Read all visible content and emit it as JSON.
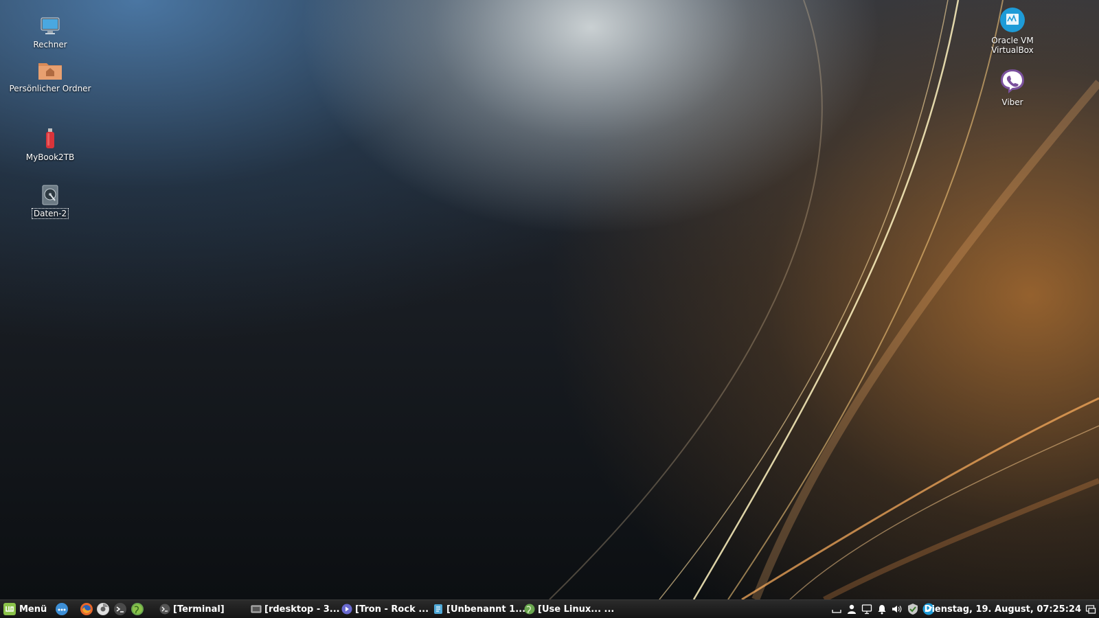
{
  "desktop": {
    "icons": [
      {
        "label": "Rechner",
        "icon": "computer-icon"
      },
      {
        "label": "Persönlicher Ordner",
        "icon": "home-folder-icon"
      },
      {
        "label": "MyBook2TB",
        "icon": "usb-drive-icon"
      },
      {
        "label": "Daten-2",
        "icon": "hard-disk-icon"
      },
      {
        "label": "Oracle VM VirtualBox",
        "icon": "virtualbox-icon"
      },
      {
        "label": "Viber",
        "icon": "viber-icon"
      }
    ]
  },
  "taskbar": {
    "menu_label": "Menü",
    "launchers": [
      "show-desktop-icon",
      "firefox-icon",
      "chrome-icon",
      "terminal-icon",
      "web-browser-icon"
    ],
    "windows": [
      {
        "label": "[Terminal]",
        "icon": "terminal-icon"
      },
      {
        "label": "[rdesktop - 3...",
        "icon": "window-icon"
      },
      {
        "label": "[Tron - Rock ...",
        "icon": "media-player-icon"
      },
      {
        "label": "[Unbenannt 1...",
        "icon": "document-icon"
      },
      {
        "label": "[Use Linux... ...",
        "icon": "web-browser-icon"
      }
    ],
    "tray": [
      "keyboard-icon",
      "user-icon",
      "network-icon",
      "notification-icon",
      "volume-icon",
      "shield-icon",
      "update-icon"
    ],
    "clock": "Dienstag, 19. August, 07:25:24",
    "show_desktop": "show-desktop-icon"
  },
  "colors": {
    "menu_green": "#8bc34a",
    "virtualbox_blue": "#1e9bd7",
    "viber_purple": "#7b519d",
    "usb_red": "#d9343a",
    "folder_orange": "#e8a070"
  }
}
